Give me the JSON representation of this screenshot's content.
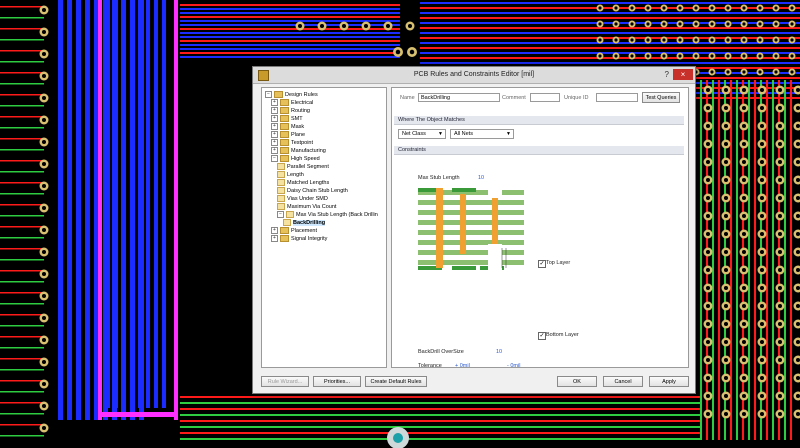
{
  "dialog": {
    "title": "PCB Rules and Constraints Editor [mil]",
    "help_glyph": "?",
    "close_glyph": "×"
  },
  "tree": {
    "items": [
      {
        "label": "Design Rules",
        "kind": "folder",
        "exp": "−",
        "indent": 0
      },
      {
        "label": "Electrical",
        "kind": "folder",
        "exp": "+",
        "indent": 1
      },
      {
        "label": "Routing",
        "kind": "folder",
        "exp": "+",
        "indent": 1
      },
      {
        "label": "SMT",
        "kind": "folder",
        "exp": "+",
        "indent": 1
      },
      {
        "label": "Mask",
        "kind": "folder",
        "exp": "+",
        "indent": 1
      },
      {
        "label": "Plane",
        "kind": "folder",
        "exp": "+",
        "indent": 1
      },
      {
        "label": "Testpoint",
        "kind": "folder",
        "exp": "+",
        "indent": 1
      },
      {
        "label": "Manufacturing",
        "kind": "folder",
        "exp": "+",
        "indent": 1
      },
      {
        "label": "High Speed",
        "kind": "folder",
        "exp": "−",
        "indent": 1
      },
      {
        "label": "Parallel Segment",
        "kind": "leaf",
        "exp": "",
        "indent": 2
      },
      {
        "label": "Length",
        "kind": "leaf",
        "exp": "",
        "indent": 2
      },
      {
        "label": "Matched Lengths",
        "kind": "leaf",
        "exp": "",
        "indent": 2
      },
      {
        "label": "Daisy Chain Stub Length",
        "kind": "leaf",
        "exp": "",
        "indent": 2
      },
      {
        "label": "Vias Under SMD",
        "kind": "leaf",
        "exp": "",
        "indent": 2
      },
      {
        "label": "Maximum Via Count",
        "kind": "leaf",
        "exp": "",
        "indent": 2
      },
      {
        "label": "Max Via Stub Length (Back Drillin",
        "kind": "leaf",
        "exp": "−",
        "indent": 2
      },
      {
        "label": "BackDrilling",
        "kind": "leaf",
        "exp": "",
        "indent": 3,
        "selected": true
      },
      {
        "label": "Placement",
        "kind": "folder",
        "exp": "+",
        "indent": 1
      },
      {
        "label": "Signal Integrity",
        "kind": "folder",
        "exp": "+",
        "indent": 1
      }
    ]
  },
  "rule": {
    "name_label": "Name",
    "name_value": "BackDrilling",
    "comment_label": "Comment",
    "comment_value": "",
    "uid_label": "Unique ID",
    "uid_value": "",
    "test_queries_label": "Test Queries"
  },
  "where": {
    "section_label": "Where The Object Matches",
    "scope_value": "Net Class",
    "target_value": "All Nets"
  },
  "constraints": {
    "section_label": "Constraints",
    "max_stub_label": "Max Stub Length",
    "max_stub_value": "10",
    "top_layer_label": "Top Layer",
    "top_layer_checked": true,
    "bottom_layer_label": "Bottom Layer",
    "bottom_layer_checked": true,
    "oversize_label": "BackDrill OverSize",
    "oversize_value": "10",
    "tolerance_label": "Tolerance",
    "tol_plus_value": "+ 0mil",
    "tol_minus_value": "- 0mil"
  },
  "buttons": {
    "rule_wizard": "Rule Wizard...",
    "priorities": "Priorities...",
    "create_default": "Create Default Rules",
    "ok": "OK",
    "cancel": "Cancel",
    "apply": "Apply"
  },
  "colors": {
    "pcb_blue": "#1a2cff",
    "pcb_red": "#ff1a1a",
    "pcb_magenta": "#ff30ff",
    "pcb_green": "#2ecc40",
    "pad": "#d8c070",
    "copper_orange": "#f0a030",
    "dielectric_green": "#8cc070"
  }
}
